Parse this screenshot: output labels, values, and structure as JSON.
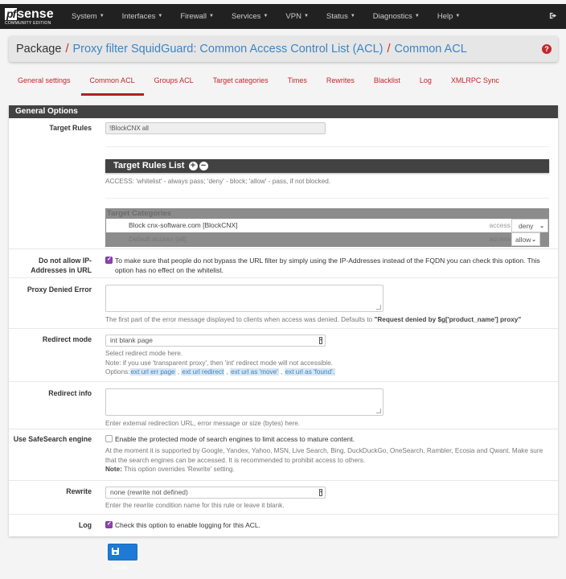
{
  "navbar": {
    "logo_main_pf": "pf",
    "logo_main_sense": "sense",
    "logo_sub": "COMMUNITY EDITION",
    "items": [
      {
        "label": "System"
      },
      {
        "label": "Interfaces"
      },
      {
        "label": "Firewall"
      },
      {
        "label": "Services"
      },
      {
        "label": "VPN"
      },
      {
        "label": "Status"
      },
      {
        "label": "Diagnostics"
      },
      {
        "label": "Help"
      }
    ],
    "logout_icon": "sign-out-icon"
  },
  "breadcrumb": {
    "root": "Package",
    "separator": "/",
    "level1": "Proxy filter SquidGuard: Common Access Control List (ACL)",
    "level2": "Common ACL",
    "help_icon": "question-circle-icon"
  },
  "tabs": [
    {
      "label": "General settings",
      "active": false
    },
    {
      "label": "Common ACL",
      "active": true
    },
    {
      "label": "Groups ACL",
      "active": false
    },
    {
      "label": "Target categories",
      "active": false
    },
    {
      "label": "Times",
      "active": false
    },
    {
      "label": "Rewrites",
      "active": false
    },
    {
      "label": "Blacklist",
      "active": false
    },
    {
      "label": "Log",
      "active": false
    },
    {
      "label": "XMLRPC Sync",
      "active": false
    }
  ],
  "panel": {
    "title": "General Options",
    "target_rules": {
      "label": "Target Rules",
      "value": "!BlockCNX all"
    },
    "target_rules_list": {
      "title": "Target Rules List",
      "add_icon": "plus-circle-icon",
      "remove_icon": "minus-circle-icon",
      "help": "ACCESS: 'whitelist' - always pass; 'deny' - block; 'allow' - pass, if not blocked."
    },
    "target_categories": {
      "title": "Target Categories",
      "rows": [
        {
          "name": "Block cnx-software.com [BlockCNX]",
          "access_label": "access",
          "access_value": "deny"
        },
        {
          "name": "Default access [all]",
          "access_label": "access",
          "access_value": "allow"
        }
      ]
    },
    "no_ip": {
      "label": "Do not allow IP-Addresses in URL",
      "checked": true,
      "text": "To make sure that people do not bypass the URL filter by simply using the IP-Addresses instead of the FQDN you can check this option. This option has no effect on the whitelist."
    },
    "proxy_denied_error": {
      "label": "Proxy Denied Error",
      "value": "",
      "help_prefix": "The first part of the error message displayed to clients when access was denied. Defaults to ",
      "help_bold": "\"Request denied by $g['product_name'] proxy\""
    },
    "redirect_mode": {
      "label": "Redirect mode",
      "value": "int blank page",
      "help_line1": "Select redirect mode here.",
      "help_line2": "Note: if you use 'transparent proxy', then 'int' redirect mode will not accessible.",
      "options_prefix": "Options:",
      "options": [
        "ext url err page",
        "ext url redirect",
        "ext url as 'move'",
        "ext url as 'found'."
      ]
    },
    "redirect_info": {
      "label": "Redirect info",
      "value": "",
      "help": "Enter external redirection URL, error message or size (bytes) here."
    },
    "safesearch": {
      "label": "Use SafeSearch engine",
      "checked": false,
      "text": "Enable the protected mode of search engines to limit access to mature content.",
      "help": "At the moment it is supported by Google, Yandex, Yahoo, MSN, Live Search, Bing, DuckDuckGo, OneSearch, Rambler, Ecosia and Qwant. Make sure that the search engines can be accessed. It is recommended to prohibit access to others.",
      "note_bold": "Note:",
      "note": " This option overrides 'Rewrite' setting."
    },
    "rewrite": {
      "label": "Rewrite",
      "value": "none (rewrite not defined)",
      "help": "Enter the rewrite condition name for this rule or leave it blank."
    },
    "log": {
      "label": "Log",
      "checked": true,
      "text": "Check this option to enable logging for this ACL."
    }
  },
  "save_button": {
    "label": "Save",
    "icon": "floppy-disk-icon",
    "color": "#1e7ad6"
  },
  "colors": {
    "navbar_bg": "#212121",
    "accent_red": "#c1272d",
    "link_blue": "#3c84c6",
    "checkbox_purple": "#8e44ad"
  }
}
